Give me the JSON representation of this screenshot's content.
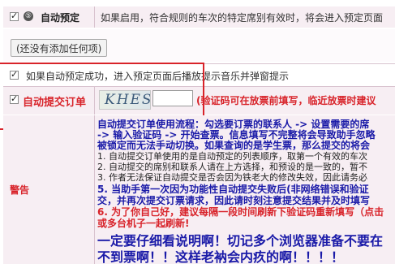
{
  "auto_reserve": {
    "label": "自动预定",
    "desc": "如果启用，符合规则的车次的特定席别有效时，将会进入预定页面"
  },
  "add_button_label": "(还没有添加任何项)",
  "music_option_label": "如果自动预定成功，进入预定页面后播放提示音乐并弹窗提示",
  "auto_submit": {
    "label": "自动提交订单",
    "captcha_text": "KHES",
    "captcha_value": "",
    "hint": "(验证码可在放票前填写，临近放票时建议"
  },
  "warning": {
    "label": "警告",
    "lines": [
      "自动提交订单使用流程：勾选要订票的联系人 -> 设置需要的席",
      "-> 输入验证码 -> 开始查票。信息填写不完整将会导致助手忽略",
      "被锁定而无法手动切换。如果查询的是学生票，那么提交的将会",
      "1. 自动提交订单使用的是自动预定的列表顺序，取第一个有效的车次",
      "2. 自动提交的席别和联系人请在上方选择，和预设的是一致的，暂不",
      "3. 作者无法保证自动提交是否会因为铁老大的修改失效，因此请务必",
      "5. 当助手第一次因为功能性自动提交失败后(非网络错误和验证",
      "交，并再次提交订票请求，因此请时刻注意提交结果并及时填写",
      "6. 为了你自己好，建议每隔一段时间刷新下验证码重新填写（点击",
      "或多台机子一起刷新!",
      "一定要仔细看说明啊！切记多个浏览器准备不要在",
      "不到票啊！！这样老衲会内疚的啊！！！！"
    ]
  },
  "colors": {
    "row_bg": "#f7eef3",
    "red": "#d8232a",
    "blue": "#1a1aa8"
  },
  "icons": {
    "help": "question-circle-icon",
    "check": "checkmark"
  }
}
